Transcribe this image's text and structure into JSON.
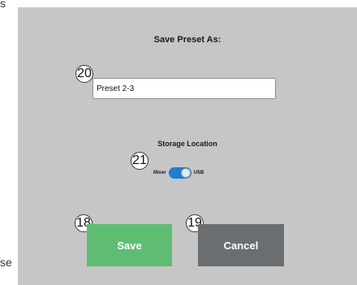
{
  "page_edge_text": {
    "top_left": "s",
    "bottom_left": "se"
  },
  "dialog": {
    "title": "Save Preset As:",
    "name_input": {
      "value": "Preset 2-3"
    },
    "storage": {
      "label": "Storage Location",
      "left_option": "Mixer",
      "right_option": "USB",
      "selected": "USB"
    },
    "buttons": {
      "save": "Save",
      "cancel": "Cancel"
    }
  },
  "callouts": {
    "name_input": "20",
    "storage_toggle": "21",
    "save_button": "18",
    "cancel_button": "19"
  },
  "colors": {
    "dialog_bg": "#c6c6c6",
    "save_green": "#5fbd73",
    "cancel_gray": "#6b6e70",
    "toggle_blue": "#1e7fd0"
  }
}
